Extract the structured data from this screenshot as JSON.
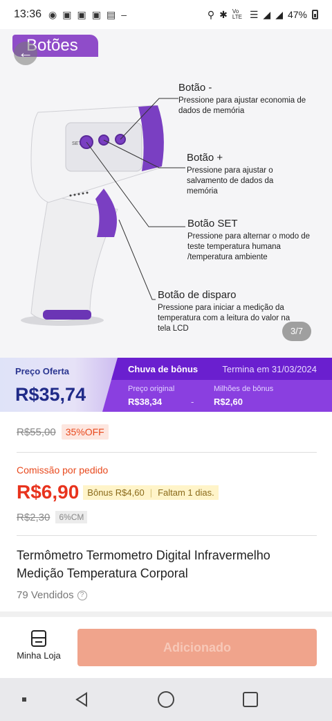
{
  "status_bar": {
    "time": "13:36",
    "notification_icons": [
      "chat-bubble-icon",
      "group-icon",
      "group-icon",
      "group-icon",
      "image-icon",
      "dash-icon"
    ],
    "signal_text": "Vo LTE",
    "battery": "47%"
  },
  "hero": {
    "section_tag": "Botões",
    "pager": "3/7",
    "device_label_set": "SET",
    "callouts": [
      {
        "title": "Botão -",
        "desc": "Pressione para ajustar economia de dados de memória"
      },
      {
        "title": "Botão +",
        "desc": "Pressione para  ajustar o salvamento de dados da memória"
      },
      {
        "title": "Botão SET",
        "desc": "Pressione para alternar o modo de teste temperatura humana /temperatura ambiente"
      },
      {
        "title": "Botão de disparo",
        "desc": "Pressione para iniciar a medição da temperatura com a leitura do valor na tela LCD"
      }
    ]
  },
  "price_banner": {
    "offer_label": "Preço Oferta",
    "offer_price": "R$35,74",
    "event_name": "Chuva de bônus",
    "ends_text": "Termina em 31/03/2024",
    "original_label": "Preço original",
    "original_value": "R$38,34",
    "separator": "-",
    "bonus_label": "Milhões de bônus",
    "bonus_value": "R$2,60"
  },
  "details": {
    "old_price": "R$55,00",
    "discount": "35%OFF",
    "commission_label": "Comissão por pedido",
    "commission_value": "R$6,90",
    "bonus_text": "Bônus R$4,60",
    "bonus_separator": "|",
    "remaining_text": "Faltam 1 dias.",
    "old_commission": "R$2,30",
    "cm_percent": "6%CM",
    "product_title": "Termômetro Termometro Digital Infravermelho Medição Temperatura Corporal",
    "sold": "79 Vendidos",
    "help_glyph": "?"
  },
  "action_bar": {
    "store_label": "Minha Loja",
    "add_label": "Adicionado"
  },
  "colors": {
    "accent_purple": "#8a3fe0",
    "price_navy": "#1f2a88",
    "commission_red": "#e8331d",
    "add_button": "#f0a48c"
  }
}
